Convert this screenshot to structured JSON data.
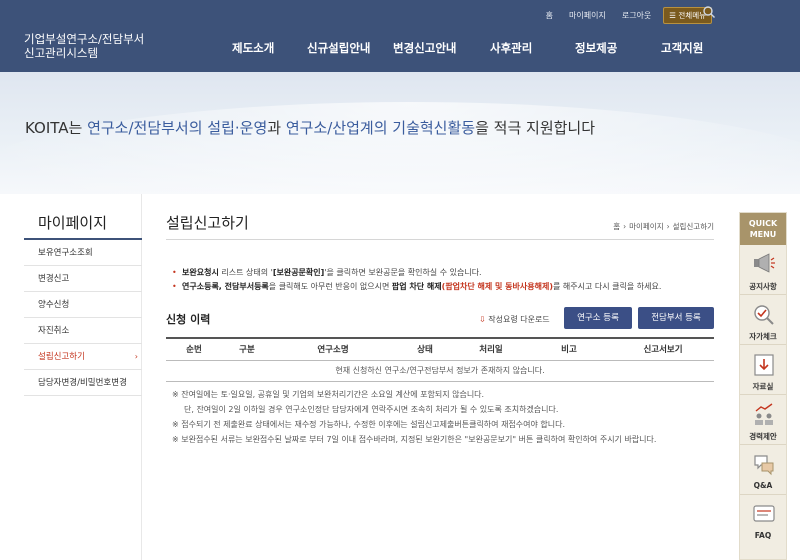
{
  "header": {
    "util": [
      "홈",
      "마이페이지",
      "로그아웃"
    ],
    "allmenu_label": "전체메뉴",
    "logo_line1": "기업부설연구소/전담부서",
    "logo_line2": "신고관리시스템",
    "gnb": [
      "제도소개",
      "신규설립안내",
      "변경신고안내",
      "사후관리",
      "정보제공",
      "고객지원"
    ]
  },
  "banner": {
    "s1": "KOITA는 ",
    "s2": "연구소/전담부서의 설립·운영",
    "s3": "과 ",
    "s4": "연구소/산업계의 기술혁신활동",
    "s5": "을 적극 지원합니다"
  },
  "sidebar": {
    "title": "마이페이지",
    "items": [
      "보유연구소조회",
      "변경신고",
      "양수신청",
      "자진취소",
      "설립신고하기",
      "담당자변경/비밀번호변경"
    ],
    "active_index": 4
  },
  "content": {
    "title": "설립신고하기",
    "breadcrumb": [
      "홈",
      "마이페이지",
      "설립신고하기"
    ],
    "notice1_a": "보완요청시",
    "notice1_b": " 리스트 상태의 '",
    "notice1_c": "[보완공문확인]",
    "notice1_d": "'을 클릭하면 보완공문을 확인하실 수 있습니다.",
    "notice2_a": "연구소등록, 전담부서등록",
    "notice2_b": "을 클릭해도 아무런 반응이 없으시면 ",
    "notice2_c": "팝업 차단 해제",
    "notice2_d": "(팝업차단 해제 및 동바사용해제)",
    "notice2_e": "를 해주시고 다시 클릭을 하세요.",
    "history_title": "신청 이력",
    "guide_download": "작성요령 다운로드",
    "btn_lab": "연구소 등록",
    "btn_dept": "전담부서 등록",
    "table_headers": [
      "순번",
      "구분",
      "연구소명",
      "상태",
      "처리일",
      "비고",
      "신고서보기"
    ],
    "table_empty": "현재 신청하신 연구소/연구전담부서 정보가 존재하지 않습니다.",
    "footnotes": [
      "※ 잔여일에는 토·일요일, 공휴일 및 기업의 보완처리기간은 소요일 계산에 포함되지 않습니다.",
      "단, 잔여일이 2일 이하일 경우 연구소인정단 담당자에게 연락주시면 조속히 처리가 될 수 있도록 조치하겠습니다.",
      "※ 접수되기 전 제출완료 상태에서는 재수정 가능하나, 수정한 이후에는 설립신고제출버튼클릭하여 재접수여야 합니다.",
      "※ 보완접수된 서류는 보완접수된 날짜로 부터 7일 이내 접수바라며, 지정된 보완기한은 \"보완공문보기\" 버튼 클릭하여 확인하여 주시기 바랍니다."
    ]
  },
  "quick_menu": {
    "head1": "QUICK",
    "head2": "MENU",
    "items": [
      {
        "label": "공지사항",
        "icon": "megaphone-icon"
      },
      {
        "label": "자가체크",
        "icon": "self-check-icon"
      },
      {
        "label": "자료실",
        "icon": "archive-icon"
      },
      {
        "label": "경력제안",
        "icon": "career-icon"
      },
      {
        "label": "Q&A",
        "icon": "qa-icon"
      },
      {
        "label": "FAQ",
        "icon": "faq-icon"
      }
    ]
  },
  "colors": {
    "header_bg": "#3d5279",
    "accent_red": "#c4361f",
    "button_blue": "#3b4f86",
    "quick_head": "#a8946a"
  }
}
